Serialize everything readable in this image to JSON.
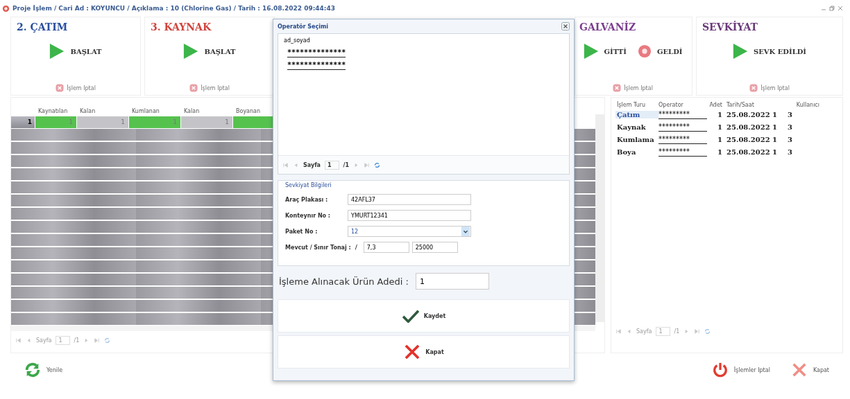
{
  "window": {
    "title": "Proje İşlem / Cari Ad : KOYUNCU / Açıklama : 10 (Chlorine Gas) / Tarih : 16.08.2022 09:44:43"
  },
  "stages": [
    {
      "title": "2. ÇATIM",
      "color": "#2a4f9e",
      "buttons": [
        {
          "label": "BAŞLAT",
          "kind": "play"
        }
      ],
      "cancel": "İşlem Iptal"
    },
    {
      "title": "3. KAYNAK",
      "color": "#d0453f",
      "buttons": [
        {
          "label": "BAŞLAT",
          "kind": "play"
        }
      ],
      "cancel": "İşlem Iptal"
    },
    {
      "title": "GALVANİZ",
      "color": "#7b3e8f",
      "buttons": [
        {
          "label": "GİTTİ",
          "kind": "play"
        },
        {
          "label": "GELDİ",
          "kind": "record"
        }
      ],
      "cancel": "İşlem Iptal"
    },
    {
      "title": "SEVKİYAT",
      "color": "#6b3a7a",
      "buttons": [
        {
          "label": "SEVK EDİLDİ",
          "kind": "play"
        }
      ],
      "cancel": "İşlem Iptal"
    }
  ],
  "left_grid": {
    "columns": [
      "Kaynatılan",
      "Kalan",
      "Kumlanan",
      "Kalan",
      "Boyanan"
    ],
    "rows": [
      {
        "row_header": "1",
        "cells": [
          {
            "value": "1",
            "done": true
          },
          {
            "value": "1",
            "done": false
          },
          {
            "value": "1",
            "done": true
          },
          {
            "value": "1",
            "done": false
          },
          {
            "done": true
          }
        ]
      }
    ],
    "pager": {
      "label": "Sayfa",
      "page": "1",
      "total": "/1"
    }
  },
  "right_grid": {
    "columns": [
      "İşlem Turu",
      "Operator",
      "Adet",
      "Tarih/Saat",
      "Kullanıcı"
    ],
    "rows": [
      {
        "type": "Çatım",
        "operator": "*********",
        "count": "1",
        "datetime": "25.08.2022 1",
        "user": "3",
        "selected": true
      },
      {
        "type": "Kaynak",
        "operator": "*********",
        "count": "1",
        "datetime": "25.08.2022 1",
        "user": "3",
        "selected": false
      },
      {
        "type": "Kumlama",
        "operator": "*********",
        "count": "1",
        "datetime": "25.08.2022 1",
        "user": "3",
        "selected": false
      },
      {
        "type": "Boya",
        "operator": "*********",
        "count": "1",
        "datetime": "25.08.2022 1",
        "user": "3",
        "selected": false
      }
    ],
    "pager": {
      "label": "Sayfa",
      "page": "1",
      "total": "/1"
    }
  },
  "dialog": {
    "title": "Operatör Seçimi",
    "column": "ad_soyad",
    "rows": [
      "**************",
      "**************"
    ],
    "pager": {
      "label": "Sayfa",
      "page": "1",
      "total": "/1"
    },
    "group_title": "Sevkiyat Bilgileri",
    "fields": [
      {
        "label": "Araç Plakası :",
        "kind": "text",
        "value": "42AFL37"
      },
      {
        "label": "Konteynır No :",
        "kind": "text",
        "value": "YMURT12341"
      },
      {
        "label": "Paket No :",
        "kind": "select",
        "value": "12"
      },
      {
        "label": "Mevcut / Sınır Tonaj :",
        "kind": "pair",
        "separator": "/",
        "value": "7,3",
        "value2": "25000"
      }
    ],
    "quantity": {
      "label": "İşleme Alınacak Ürün Adedi :",
      "value": "1"
    },
    "buttons": [
      {
        "label": "Kaydet",
        "kind": "save"
      },
      {
        "label": "Kapat",
        "kind": "close"
      }
    ]
  },
  "footer": {
    "left": [
      {
        "label": "Yenile",
        "kind": "refresh"
      }
    ],
    "right": [
      {
        "label": "İşlemler Iptal",
        "kind": "power"
      },
      {
        "label": "Kapat",
        "kind": "close"
      }
    ]
  }
}
